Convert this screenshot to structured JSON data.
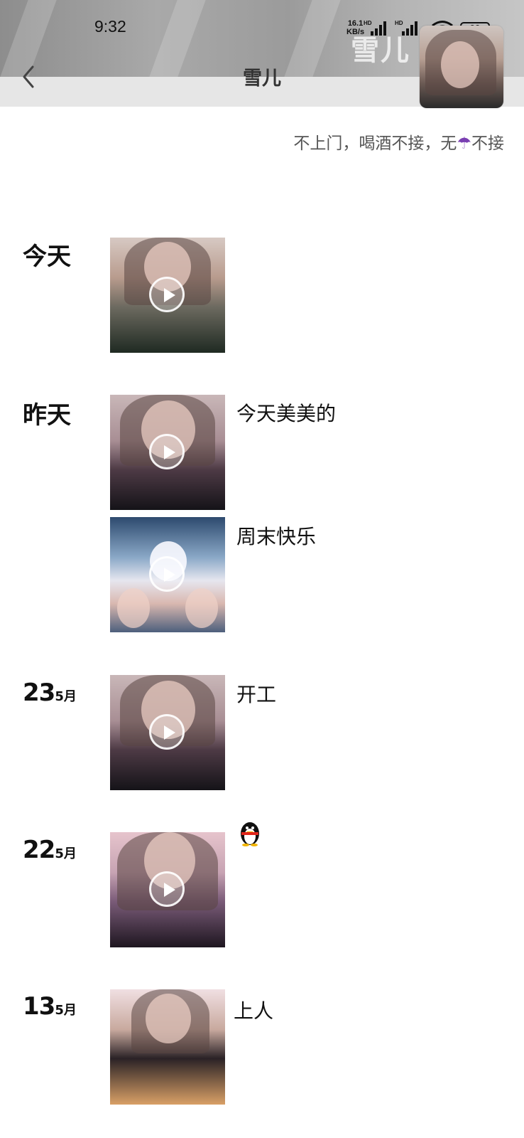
{
  "status_bar": {
    "time": "9:32",
    "speed_value": "16.1",
    "speed_unit": "KB/s",
    "battery": "90"
  },
  "header": {
    "cover_title": "雪儿",
    "title": "雪儿",
    "signature": "不上门，喝酒不接，无",
    "signature_tail": "不接"
  },
  "timeline": [
    {
      "date_word": "今天",
      "posts": [
        {
          "caption": ""
        }
      ]
    },
    {
      "date_word": "昨天",
      "posts": [
        {
          "caption": "今天美美的"
        },
        {
          "caption": "周末快乐"
        }
      ]
    },
    {
      "day": "23",
      "month": "5月",
      "posts": [
        {
          "caption": "开工"
        }
      ]
    },
    {
      "day": "22",
      "month": "5月",
      "posts": [
        {
          "caption": ""
        }
      ]
    },
    {
      "day": "13",
      "month": "5月",
      "posts": [
        {
          "caption": "上人"
        }
      ]
    }
  ],
  "colors": {
    "nav_bar": "#e6e6e6",
    "umbrella_emoji": "#7a3fb2"
  },
  "icons": [
    "back-chevron-icon",
    "signal-icon",
    "wifi-icon",
    "battery-icon",
    "play-icon",
    "umbrella-emoji-icon",
    "penguin-emoji-icon"
  ]
}
